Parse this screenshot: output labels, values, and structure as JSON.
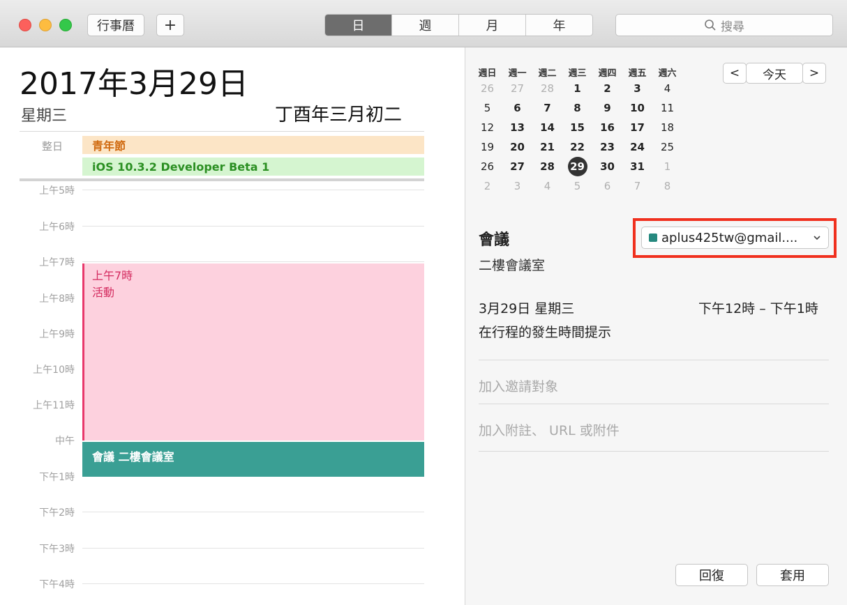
{
  "toolbar": {
    "calendars_label": "行事曆",
    "add_label": "+",
    "views": [
      "日",
      "週",
      "月",
      "年"
    ],
    "active_view": "日",
    "search_placeholder": "搜尋"
  },
  "day": {
    "date": "2017年3月29日",
    "weekday": "星期三",
    "lunar": "丁酉年三月初二",
    "allday_label": "整日",
    "allday_events": [
      {
        "title": "青年節",
        "color": "#d06a10"
      },
      {
        "title": "iOS 10.3.2 Developer Beta 1",
        "color": "#2b8f22"
      }
    ],
    "hours": [
      "上午5時",
      "上午6時",
      "上午7時",
      "上午8時",
      "上午9時",
      "上午10時",
      "上午11時",
      "中午",
      "下午1時",
      "下午2時",
      "下午3時",
      "下午4時"
    ],
    "events": [
      {
        "time": "上午7時",
        "title": "活動",
        "color": "#fdd1de"
      },
      {
        "title": "會議  二樓會議室",
        "color": "#3a9f94"
      }
    ]
  },
  "mini_calendar": {
    "weekdays": [
      "週日",
      "週一",
      "週二",
      "週三",
      "週四",
      "週五",
      "週六"
    ],
    "weeks": [
      [
        "26",
        "27",
        "28",
        "1",
        "2",
        "3",
        "4"
      ],
      [
        "5",
        "6",
        "7",
        "8",
        "9",
        "10",
        "11"
      ],
      [
        "12",
        "13",
        "14",
        "15",
        "16",
        "17",
        "18"
      ],
      [
        "19",
        "20",
        "21",
        "22",
        "23",
        "24",
        "25"
      ],
      [
        "26",
        "27",
        "28",
        "29",
        "30",
        "31",
        "1"
      ],
      [
        "2",
        "3",
        "4",
        "5",
        "6",
        "7",
        "8"
      ]
    ],
    "selected": "29",
    "prev": "<",
    "today": "今天",
    "next": ">"
  },
  "detail": {
    "title": "會議",
    "location": "二樓會議室",
    "calendar": "aplus425tw@gmail....",
    "calendar_color": "#26897f",
    "date": "3月29日 星期三",
    "time": "下午12時 – 下午1時",
    "alert": "在行程的發生時間提示",
    "invitees_placeholder": "加入邀請對象",
    "notes_placeholder": "加入附註、 URL 或附件",
    "revert_label": "回復",
    "apply_label": "套用"
  }
}
